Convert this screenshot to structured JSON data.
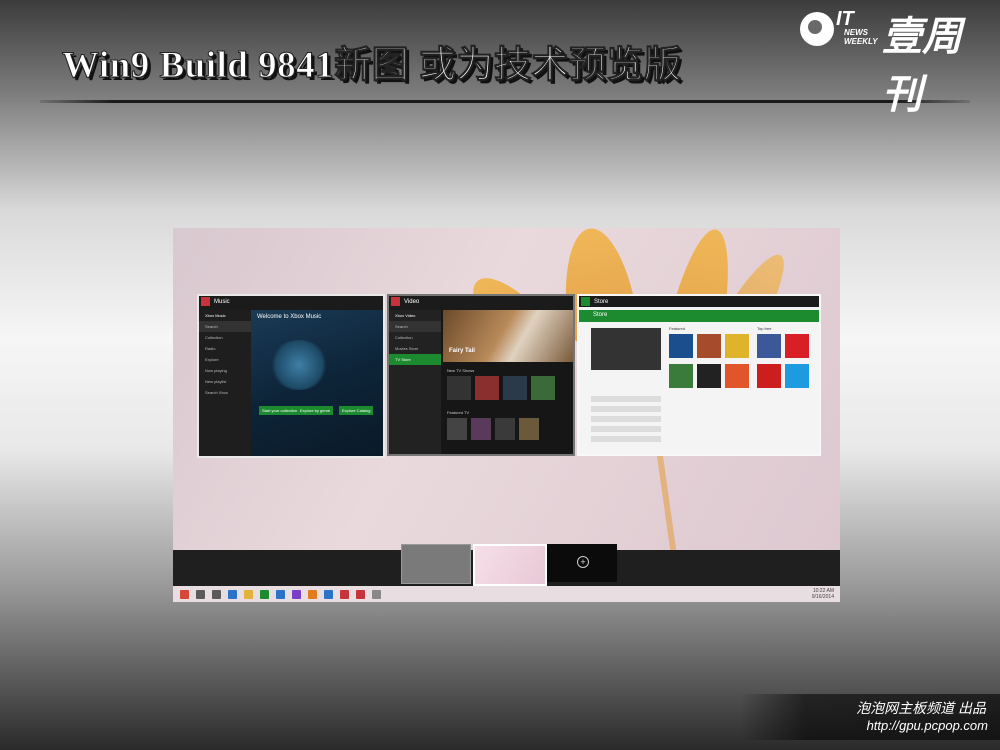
{
  "slide": {
    "title": "Win9 Build 9841新图 或为技术预览版"
  },
  "logo": {
    "it": "IT",
    "news": "NEWS\nWEEKLY",
    "cn": "壹周刊"
  },
  "task_view": {
    "windows": [
      {
        "app": "Music",
        "accent": "#c8323b",
        "heading": "Welcome to Xbox Music",
        "sidebar": [
          "Xbox Music",
          "Search",
          "Collection",
          "Radio",
          "Explore",
          "Now playing",
          "New playlist",
          "Search Xbox"
        ],
        "buttons": [
          "Start your collection",
          "Explore by genre",
          "Explore Catalog"
        ]
      },
      {
        "app": "Video",
        "accent": "#c8323b",
        "heading": "Fairy Tail",
        "sidebar": [
          "Xbox Video",
          "Search",
          "Collection",
          "Movies Store",
          "TV Store"
        ],
        "sections": [
          "New TV Shows",
          "Featured TV"
        ]
      },
      {
        "app": "Store",
        "accent": "#1c8a2e",
        "heading": "Store",
        "sections": [
          "Featured",
          "Top free"
        ]
      }
    ],
    "desktop_add_label": "+"
  },
  "taskbar": {
    "time": "10:22 AM",
    "date": "9/16/2014",
    "icons": [
      {
        "name": "start",
        "color": "#d8453a"
      },
      {
        "name": "search",
        "color": "#5a5a5a"
      },
      {
        "name": "task-view",
        "color": "#5a5a5a"
      },
      {
        "name": "internet-explorer",
        "color": "#2a73c8"
      },
      {
        "name": "file-explorer",
        "color": "#e2b23c"
      },
      {
        "name": "store",
        "color": "#1c8a2e"
      },
      {
        "name": "app-blue",
        "color": "#2a73c8"
      },
      {
        "name": "app-purple",
        "color": "#7a3ec8"
      },
      {
        "name": "app-orange",
        "color": "#e27b1c"
      },
      {
        "name": "app-grid",
        "color": "#2a73c8"
      },
      {
        "name": "video",
        "color": "#c8323b"
      },
      {
        "name": "music",
        "color": "#c8323b"
      },
      {
        "name": "app-gray",
        "color": "#888888"
      }
    ]
  },
  "footer": {
    "credit": "泡泡网主板频道 出品",
    "url": "http://gpu.pcpop.com"
  }
}
